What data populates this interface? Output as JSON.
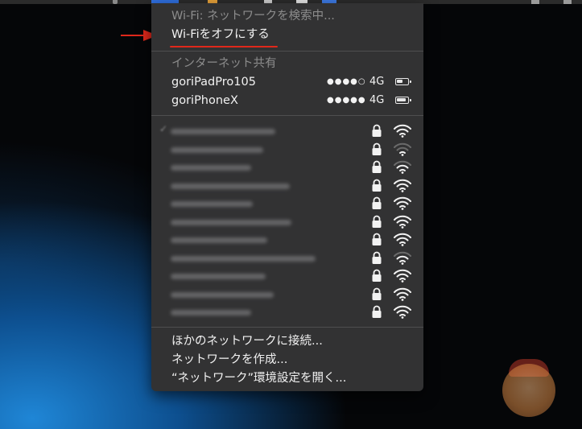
{
  "wifi_menu": {
    "status_label": "Wi-Fi: ネットワークを検索中...",
    "turn_off_label": "Wi-Fiをオフにする",
    "hotspot_header": "インターネット共有",
    "hotspots": [
      {
        "name": "goriPadPro105",
        "signal": "●●●●○",
        "network": "4G",
        "battery_level": 0.55
      },
      {
        "name": "goriPhoneX",
        "signal": "●●●●●",
        "network": "4G",
        "battery_level": 0.9
      }
    ],
    "other_networks_count_label": "",
    "actions": {
      "join_other": "ほかのネットワークに接続...",
      "create_network": "ネットワークを作成...",
      "open_prefs": "“ネットワーク”環境設定を開く..."
    }
  },
  "annotation": {
    "arrow_color": "#e0281b",
    "underline_color": "#e0281b"
  },
  "networks_blurred": [
    {
      "signal_bars": 3,
      "selected": true
    },
    {
      "signal_bars": 1
    },
    {
      "signal_bars": 2
    },
    {
      "signal_bars": 3
    },
    {
      "signal_bars": 3
    },
    {
      "signal_bars": 3
    },
    {
      "signal_bars": 3
    },
    {
      "signal_bars": 2
    },
    {
      "signal_bars": 3
    },
    {
      "signal_bars": 3
    },
    {
      "signal_bars": 3
    }
  ]
}
